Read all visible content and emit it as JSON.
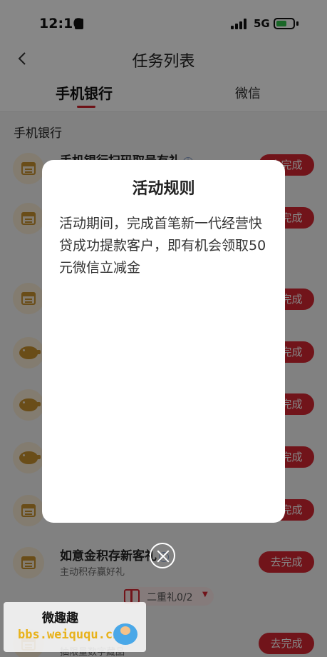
{
  "status_bar": {
    "time": "12:16",
    "network": "5G"
  },
  "nav": {
    "title": "任务列表"
  },
  "tabs": [
    {
      "label": "手机银行"
    },
    {
      "label": "微信"
    }
  ],
  "section_title": "手机银行",
  "tasks": [
    {
      "title": "手机银行扫码取号有礼",
      "subtitle": "",
      "button": "去完成",
      "icon": "calendar-icon"
    },
    {
      "title": "",
      "subtitle": "",
      "button": "去完成",
      "icon": "calendar-icon"
    },
    {
      "title": "",
      "subtitle": "",
      "button": "去完成",
      "icon": "calendar-icon"
    },
    {
      "title": "",
      "subtitle": "",
      "button": "去完成",
      "icon": "piggy-bank-icon"
    },
    {
      "title": "",
      "subtitle": "",
      "button": "去完成",
      "icon": "piggy-bank-icon"
    },
    {
      "title": "",
      "subtitle": "",
      "button": "去完成",
      "icon": "piggy-bank-icon"
    },
    {
      "title": "",
      "subtitle": "",
      "button": "去完成",
      "icon": "calendar-icon"
    },
    {
      "title": "如意金积存新客礼",
      "subtitle": "主动积存赢好礼",
      "button": "去完成",
      "icon": "calendar-icon"
    },
    {
      "title": "",
      "subtitle": "抽限量数字藏品",
      "button": "去完成",
      "icon": "calendar-icon"
    }
  ],
  "gift_progress": {
    "label": "二重礼0/2"
  },
  "modal": {
    "title": "活动规则",
    "body": "活动期间，完成首笔新一代经营快贷成功提款客户，即有机会领取50元微信立减金"
  },
  "watermark": {
    "title": "微趣趣",
    "url": "bbs.weiququ.cn"
  },
  "colors": {
    "accent": "#d52631",
    "icon_gold": "#c9922e",
    "icon_bg": "#f7ead3",
    "battery": "#32c24d"
  }
}
